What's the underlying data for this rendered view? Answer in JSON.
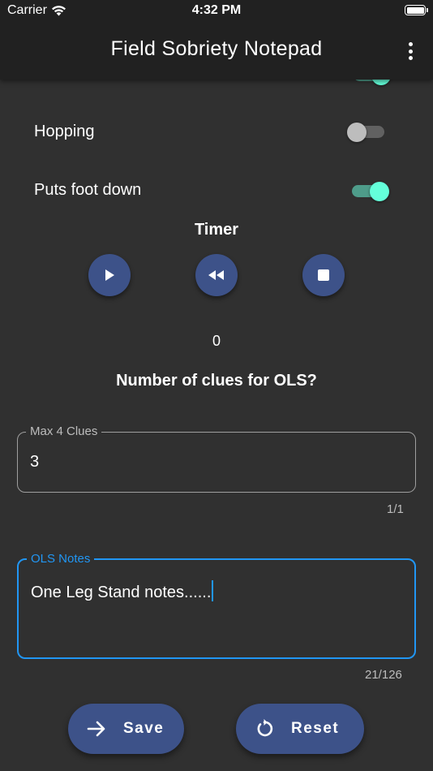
{
  "status_bar": {
    "carrier": "Carrier",
    "time": "4:32 PM"
  },
  "app_bar": {
    "title": "Field Sobriety Notepad",
    "menu_icon": "more-vert-icon"
  },
  "checklist": [
    {
      "label": "Hopping",
      "checked": false
    },
    {
      "label": "Puts foot down",
      "checked": true
    }
  ],
  "partial_switch_checked": true,
  "timer": {
    "title": "Timer",
    "count": "0",
    "buttons": [
      "play-icon",
      "rewind-icon",
      "stop-icon"
    ]
  },
  "clues": {
    "question": "Number of clues for OLS?",
    "label": "Max 4 Clues",
    "value": "3",
    "counter": "1/1"
  },
  "notes": {
    "label": "OLS Notes",
    "value": "One Leg Stand notes......",
    "counter": "21/126"
  },
  "actions": {
    "save_label": "Save",
    "save_icon": "arrow-right-icon",
    "reset_label": "Reset",
    "reset_icon": "refresh-icon"
  },
  "colors": {
    "background": "#303030",
    "app_bar": "#212121",
    "accent": "#64ffda",
    "button": "#3d5289",
    "focus": "#2196f3"
  }
}
